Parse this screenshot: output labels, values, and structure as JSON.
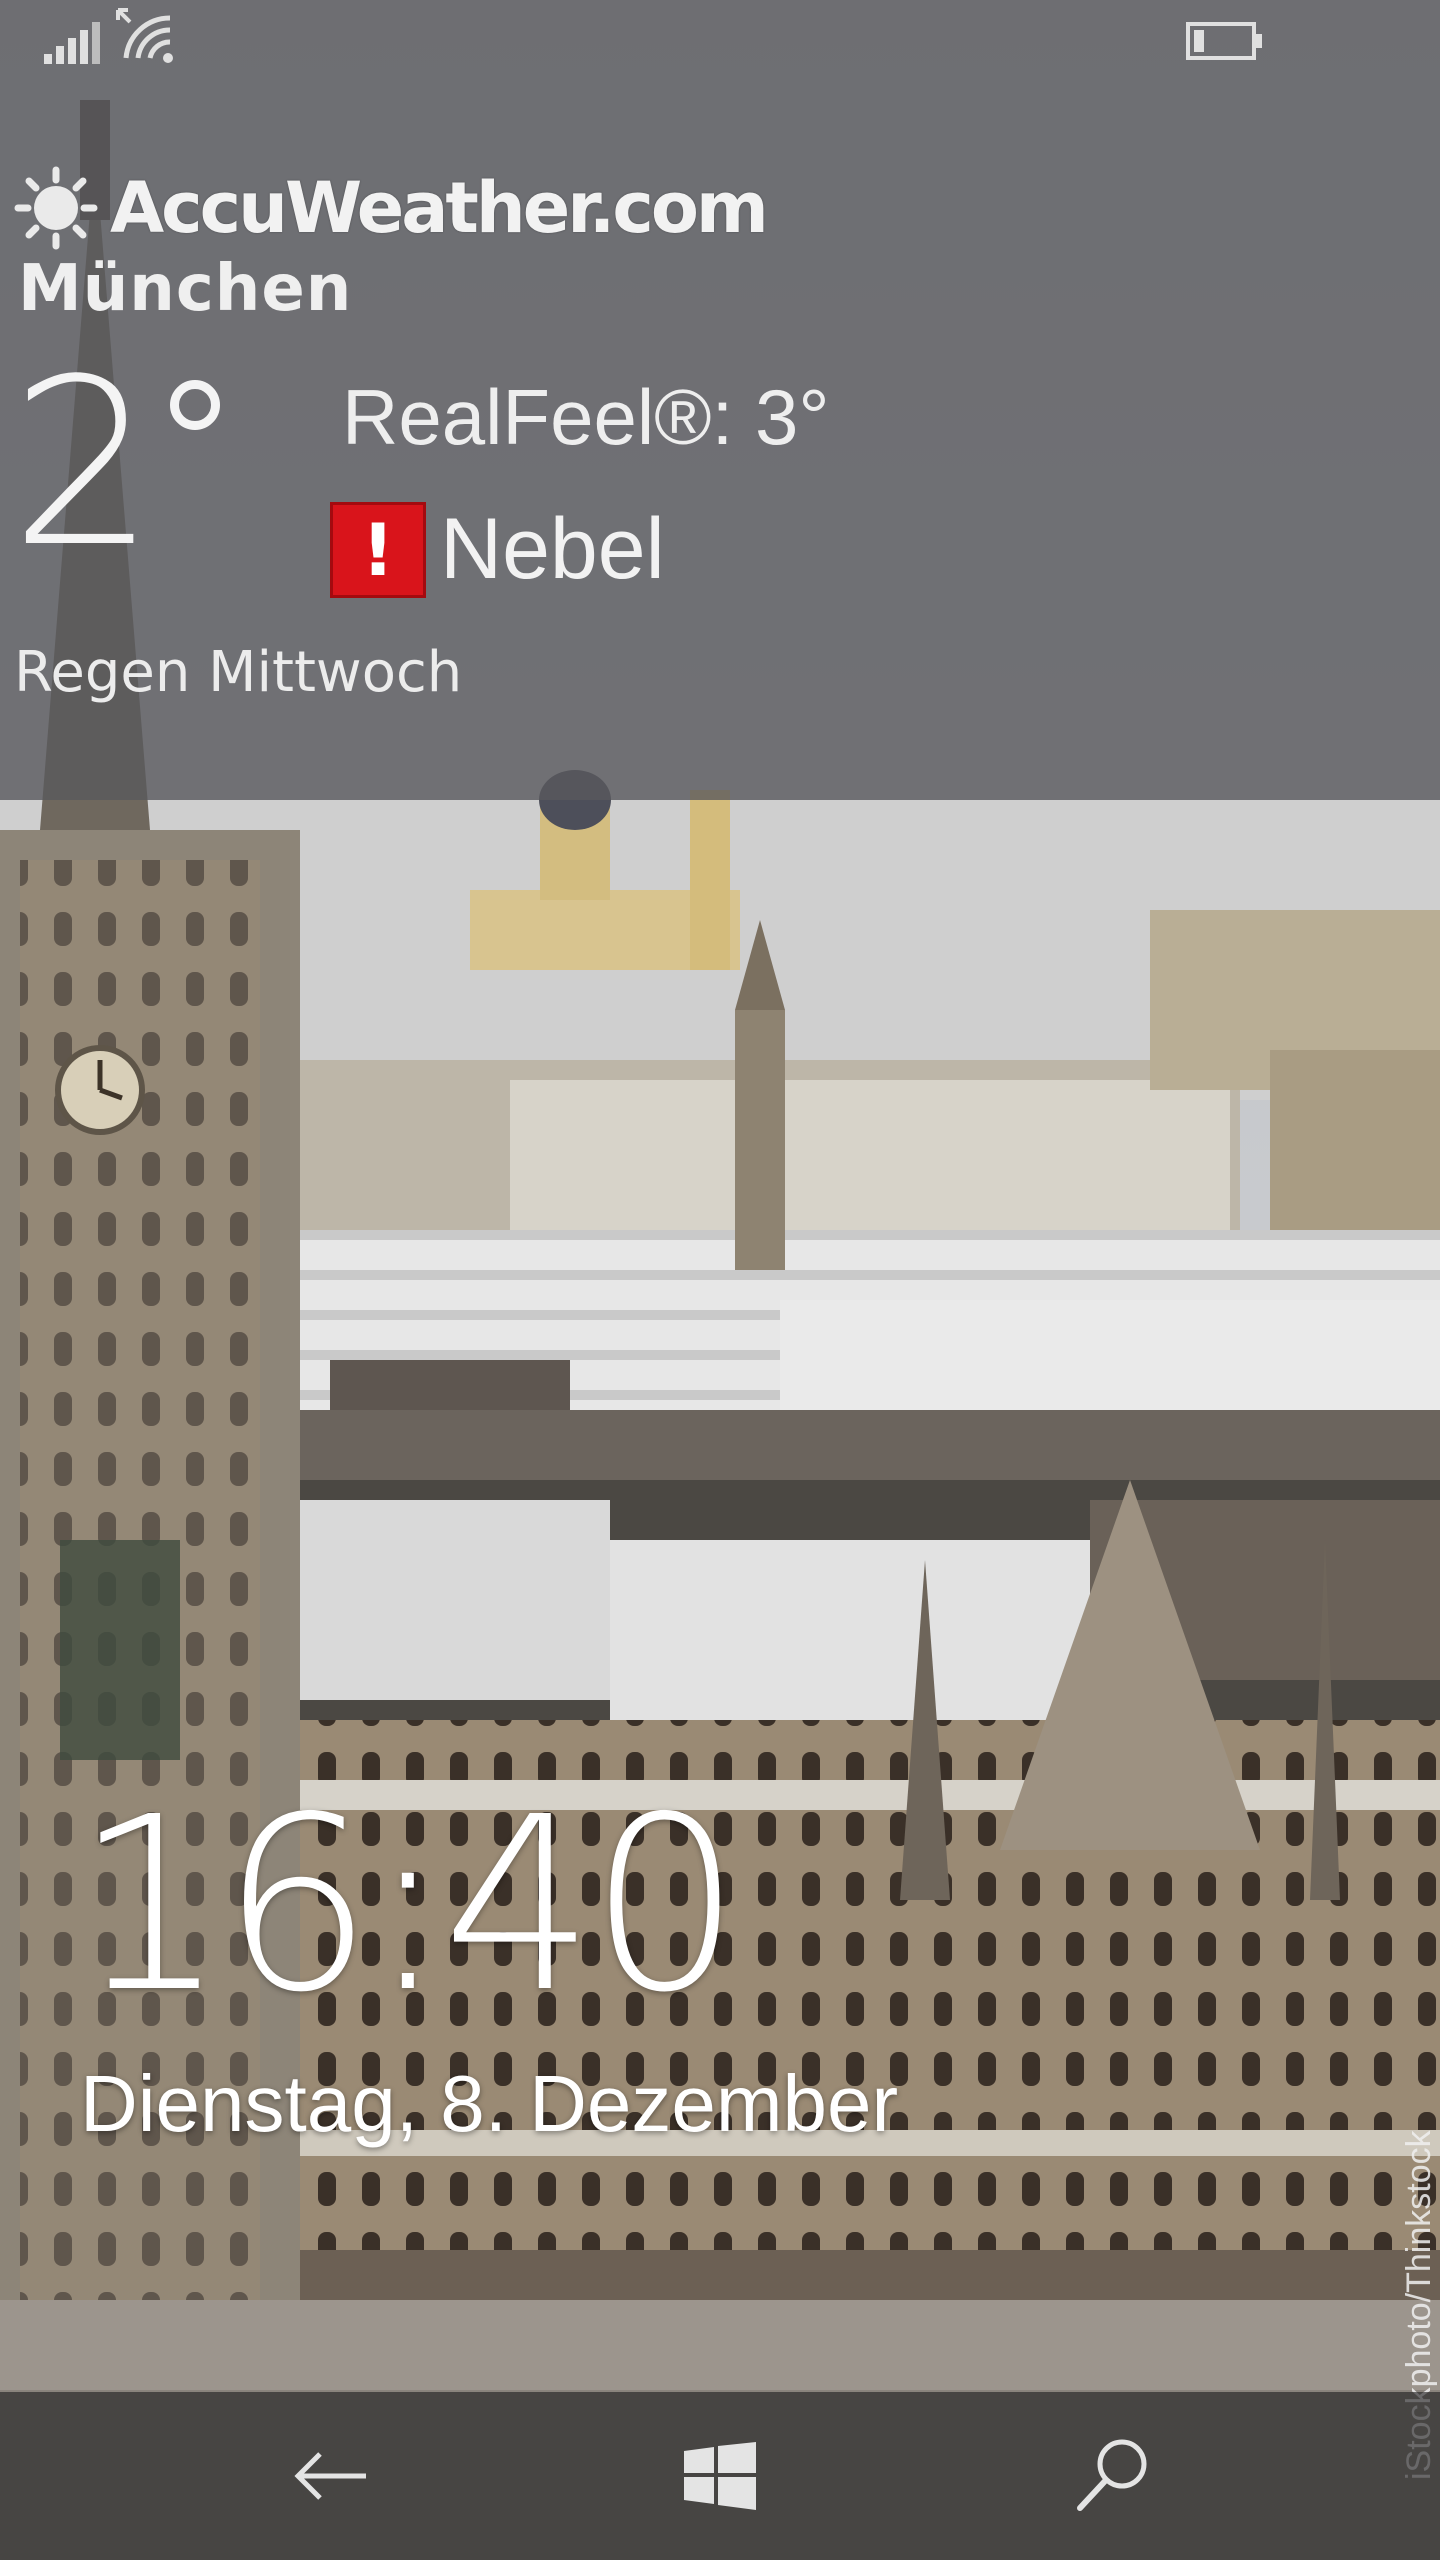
{
  "status_bar": {
    "signal_icon": "signal-bars-icon",
    "wifi_icon": "wifi-icon",
    "battery_icon": "battery-icon"
  },
  "weather": {
    "provider": "AccuWeather.com",
    "city": "München",
    "temperature": "2",
    "realfeel": "RealFeel®: 3°",
    "alert_icon": "!",
    "condition": "Nebel",
    "forecast": "Regen Mittwoch"
  },
  "lockscreen": {
    "time": "16:40",
    "date": "Dienstag, 8. Dezember",
    "photo_credit": "iStockphoto/Thinkstock"
  },
  "navigation": {
    "back_icon": "back-arrow-icon",
    "start_icon": "windows-logo-icon",
    "search_icon": "search-icon"
  },
  "colors": {
    "alert_red": "#d9141b",
    "overlay_gray": "#58585c"
  }
}
